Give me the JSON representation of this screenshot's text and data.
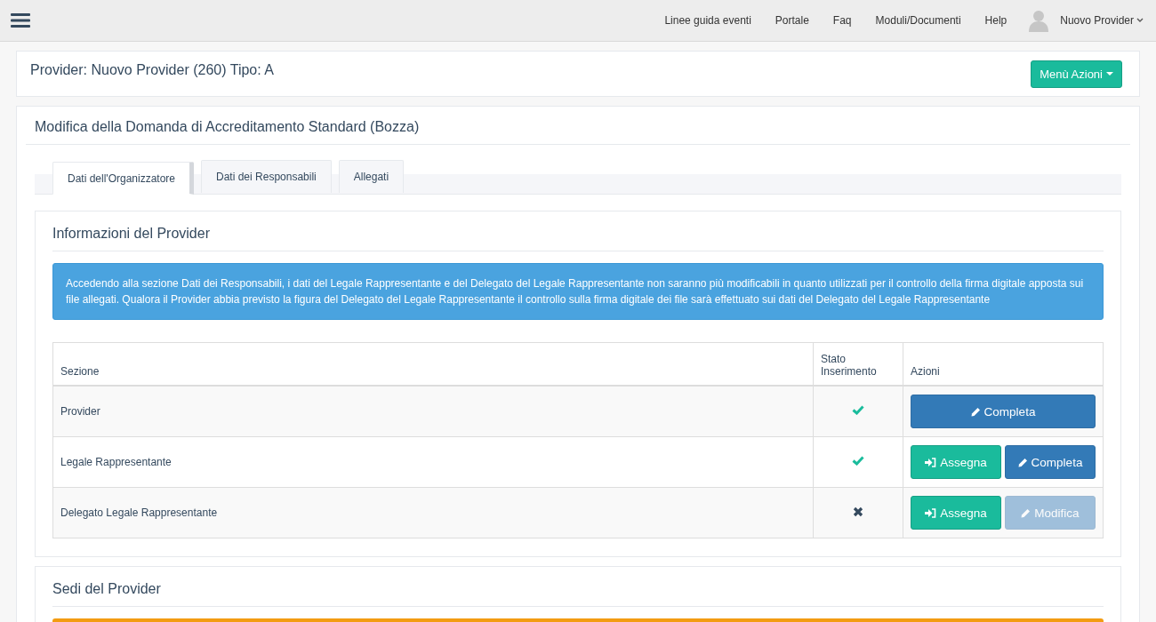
{
  "navbar": {
    "links": [
      "Linee guida eventi",
      "Portale",
      "Faq",
      "Moduli/Documenti",
      "Help"
    ],
    "user": "Nuovo Provider"
  },
  "provider_panel": {
    "title": "Provider: Nuovo Provider (260) Tipo: A",
    "menu_button": "Menù Azioni"
  },
  "form_panel": {
    "title": "Modifica della Domanda di Accreditamento Standard (Bozza)",
    "tabs": [
      {
        "label": "Dati dell'Organizzatore",
        "selected": true
      },
      {
        "label": "Dati dei Responsabili",
        "selected": false
      },
      {
        "label": "Allegati",
        "selected": false
      }
    ],
    "info_section": {
      "title": "Informazioni del Provider",
      "alert": "Accedendo alla sezione Dati dei Responsabili, i dati del Legale Rappresentante e del Delegato del Legale Rappresentante non saranno più modificabili in quanto utilizzati per il controllo della firma digitale apposta sui file allegati. Qualora il Provider abbia previsto la figura del Delegato del Legale Rappresentante il controllo sulla firma digitale dei file sarà effettuato sui dati del Delegato del Legale Rappresentante",
      "table": {
        "columns": [
          "Sezione",
          "Stato Inserimento",
          "Azioni"
        ],
        "rows": [
          {
            "section": "Provider",
            "complete": true,
            "actions": [
              {
                "kind": "edit",
                "label": "Completa",
                "disabled": false
              }
            ]
          },
          {
            "section": "Legale Rappresentante",
            "complete": true,
            "actions": [
              {
                "kind": "assign",
                "label": "Assegna",
                "disabled": false
              },
              {
                "kind": "edit",
                "label": "Completa",
                "disabled": false
              }
            ]
          },
          {
            "section": "Delegato Legale Rappresentante",
            "complete": false,
            "actions": [
              {
                "kind": "assign",
                "label": "Assegna",
                "disabled": false
              },
              {
                "kind": "edit",
                "label": "Modifica",
                "disabled": true
              }
            ]
          }
        ]
      }
    },
    "sedi_section": {
      "title": "Sedi del Provider"
    }
  }
}
